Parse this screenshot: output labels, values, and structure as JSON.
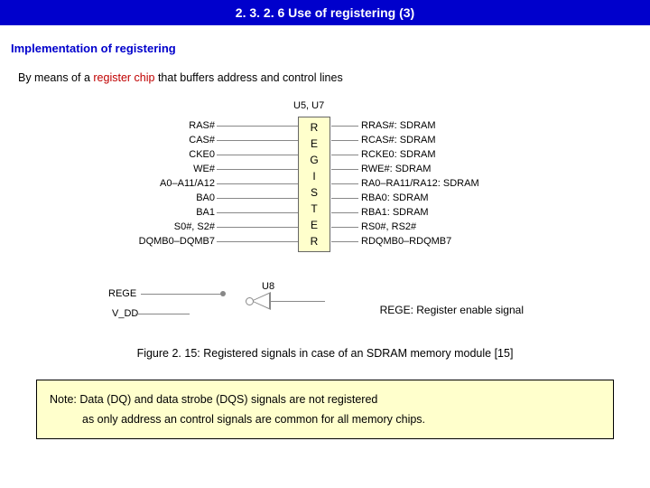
{
  "header": {
    "title": "2. 3. 2. 6  Use of registering (3)"
  },
  "subhead": "Implementation of registering",
  "intro": {
    "before": "By means of a ",
    "red": "register chip",
    "after": " that buffers address and control lines"
  },
  "diagram": {
    "u_label": "U5, U7",
    "reg_letters": [
      "R",
      "E",
      "G",
      "I",
      "S",
      "T",
      "E",
      "R"
    ],
    "left_signals": [
      "RAS#",
      "CAS#",
      "CKE0",
      "WE#",
      "A0–A11/A12",
      "BA0",
      "BA1",
      "S0#, S2#",
      "DQMB0–DQMB7"
    ],
    "right_signals": [
      "RRAS#: SDRAM",
      "RCAS#: SDRAM",
      "RCKE0: SDRAM",
      "RWE#: SDRAM",
      "RA0–RA11/RA12: SDRAM",
      "RBA0: SDRAM",
      "RBA1: SDRAM",
      "RS0#, RS2#",
      "RDQMB0–RDQMB7"
    ]
  },
  "lower": {
    "rege": "REGE",
    "vdd": "V_DD",
    "u8": "U8",
    "explain": "REGE: Register enable signal"
  },
  "caption": "Figure 2. 15: Registered signals in case of an SDRAM memory module [15]",
  "note": {
    "line1": "Note: Data (DQ) and data strobe (DQS) signals are not registered",
    "line2": "as only address an control signals are common for all memory chips."
  }
}
